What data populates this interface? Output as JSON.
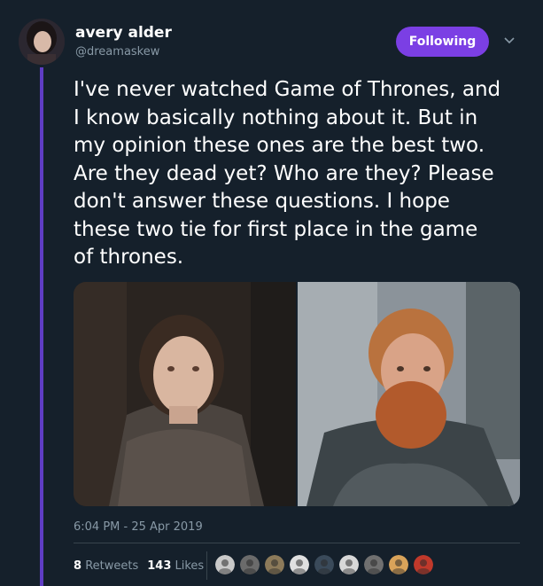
{
  "author": {
    "display_name": "avery alder",
    "handle": "@dreamaskew"
  },
  "follow_button": {
    "label": "Following"
  },
  "tweet": {
    "text": "I've never watched Game of Thrones, and\nI know basically nothing about it. But in\nmy opinion these ones are the best two.\nAre they dead yet? Who are they? Please\ndon't answer these questions. I hope\nthese two tie for first place in the game\nof thrones.",
    "timestamp": "6:04 PM - 25 Apr 2019"
  },
  "stats": {
    "retweets_count": "8",
    "retweets_label": "Retweets",
    "likes_count": "143",
    "likes_label": "Likes"
  },
  "colors": {
    "background": "#15202b",
    "accent": "#7b3fe4",
    "thread_line": "#5f3dc4",
    "secondary_text": "#8899a6"
  },
  "likers": [
    "liker-avatar-1",
    "liker-avatar-2",
    "liker-avatar-3",
    "liker-avatar-4",
    "liker-avatar-5",
    "liker-avatar-6",
    "liker-avatar-7",
    "liker-avatar-8",
    "liker-avatar-9"
  ]
}
